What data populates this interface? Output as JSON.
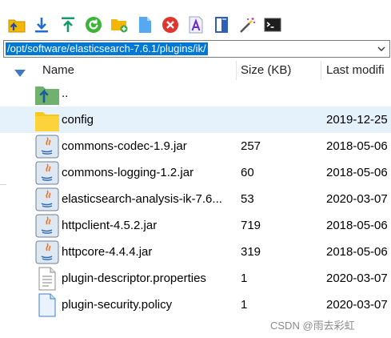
{
  "path": {
    "value": "/opt/software/elasticsearch-7.6.1/plugins/ik/"
  },
  "toolbar": {
    "buttons": [
      {
        "name": "parent-folder-icon"
      },
      {
        "name": "download-icon"
      },
      {
        "name": "upload-icon"
      },
      {
        "name": "refresh-icon"
      },
      {
        "name": "new-folder-icon"
      },
      {
        "name": "new-file-icon"
      },
      {
        "name": "delete-icon"
      },
      {
        "name": "rename-icon"
      },
      {
        "name": "properties-icon"
      },
      {
        "name": "magic-wand-icon"
      },
      {
        "name": "terminal-icon"
      }
    ]
  },
  "columns": {
    "name": "Name",
    "size": "Size (KB)",
    "date": "Last modifi"
  },
  "files": [
    {
      "name": "..",
      "size": "",
      "date": "",
      "type": "parent"
    },
    {
      "name": "config",
      "size": "",
      "date": "2019-12-25",
      "type": "folder"
    },
    {
      "name": "commons-codec-1.9.jar",
      "size": "257",
      "date": "2018-05-06",
      "type": "jar"
    },
    {
      "name": "commons-logging-1.2.jar",
      "size": "60",
      "date": "2018-05-06",
      "type": "jar"
    },
    {
      "name": "elasticsearch-analysis-ik-7.6...",
      "size": "53",
      "date": "2020-03-07",
      "type": "jar"
    },
    {
      "name": "httpclient-4.5.2.jar",
      "size": "719",
      "date": "2018-05-06",
      "type": "jar"
    },
    {
      "name": "httpcore-4.4.4.jar",
      "size": "319",
      "date": "2018-05-06",
      "type": "jar"
    },
    {
      "name": "plugin-descriptor.properties",
      "size": "1",
      "date": "2020-03-07",
      "type": "text"
    },
    {
      "name": "plugin-security.policy",
      "size": "1",
      "date": "2020-03-07",
      "type": "policy"
    }
  ],
  "watermark": "CSDN @雨去彩虹",
  "colors": {
    "selection": "#0078d7",
    "row_highlight": "#e5f1fb",
    "folder": "#f8c81c"
  }
}
